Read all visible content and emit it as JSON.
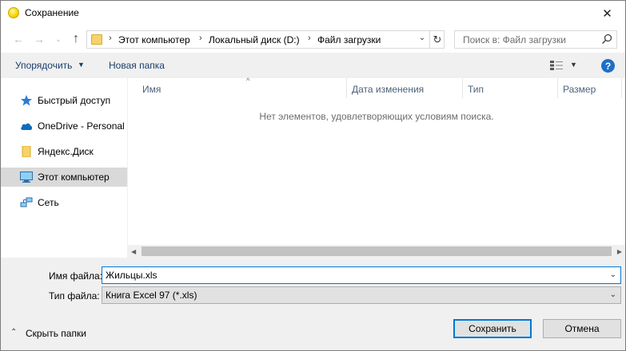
{
  "window": {
    "title": "Сохранение",
    "close_glyph": "✕"
  },
  "nav": {
    "back_glyph": "←",
    "forward_glyph": "→",
    "recent_glyph": "⌄",
    "up_glyph": "↑",
    "breadcrumbs": [
      "Этот компьютер",
      "Локальный диск (D:)",
      "Файл загрузки"
    ],
    "separator": "›",
    "dropdown_glyph": "⌄",
    "refresh_glyph": "↻"
  },
  "search": {
    "placeholder": "Поиск в: Файл загрузки"
  },
  "toolbar": {
    "organize_label": "Упорядочить",
    "organize_caret": "▼",
    "new_folder_label": "Новая папка",
    "view_caret": "▼",
    "help_label": "?"
  },
  "sidebar": {
    "items": [
      {
        "label": "Быстрый доступ",
        "icon": "star-icon",
        "selected": false
      },
      {
        "label": "OneDrive - Personal",
        "icon": "cloud-icon",
        "selected": false
      },
      {
        "label": "Яндекс.Диск",
        "icon": "folder-icon",
        "selected": false
      },
      {
        "label": "Этот компьютер",
        "icon": "computer-icon",
        "selected": true
      },
      {
        "label": "Сеть",
        "icon": "network-icon",
        "selected": false
      }
    ]
  },
  "files": {
    "columns": [
      "Имя",
      "Дата изменения",
      "Тип",
      "Размер"
    ],
    "sort_glyph": "^",
    "empty_message": "Нет элементов, удовлетворяющих условиям поиска.",
    "scroll_left_glyph": "◀",
    "scroll_right_glyph": "▶"
  },
  "form": {
    "filename_label": "Имя файла:",
    "filename_value": "Жильцы.xls",
    "filetype_label": "Тип файла:",
    "filetype_value": "Книга Excel 97 (*.xls)",
    "dropdown_glyph": "⌄"
  },
  "footer": {
    "hide_folders_glyph": "⌃",
    "hide_folders_label": "Скрыть папки",
    "save_label": "Сохранить",
    "cancel_label": "Отмена"
  },
  "colors": {
    "accent": "#0078d7",
    "selected_bg": "#d9d9d9",
    "link_text": "#1a3f6b",
    "header_text": "#4c607a"
  }
}
